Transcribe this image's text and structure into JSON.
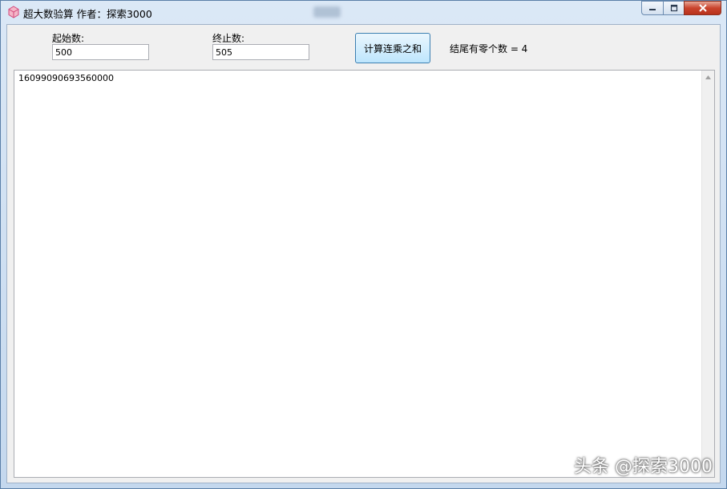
{
  "window": {
    "title": "超大数验算  作者：探索3000",
    "icon": "app-cube-icon",
    "caption_icons": [
      "minimize-icon",
      "maximize-icon",
      "close-icon"
    ]
  },
  "form": {
    "start_label": "起始数:",
    "start_value": "500",
    "end_label": "终止数:",
    "end_value": "505",
    "calc_button": "计算连乘之和",
    "zero_count_text": "结尾有零个数 = 4"
  },
  "output": {
    "result": "16099090693560000"
  },
  "watermark": "头条 @探索3000",
  "colors": {
    "close_button": "#c9442d",
    "accent_button": "#bee6fd"
  }
}
